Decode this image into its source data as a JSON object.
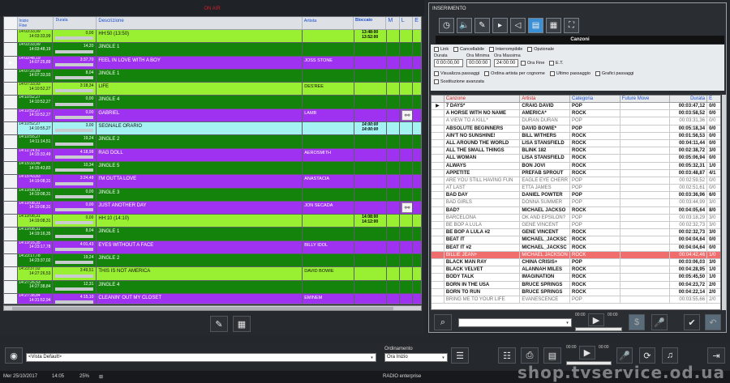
{
  "left_panel": {
    "header_title": "ON AIR",
    "columns": [
      "Inizio\nFine",
      "Durata",
      "Descrizione",
      "Artista",
      "Bloccato",
      "M",
      "L",
      "E"
    ],
    "rows": [
      {
        "start": "14:03:33,99",
        "end": "14:03:33,99",
        "dur": "0,00",
        "desc": "HH:50 (13:50)",
        "artist": "",
        "locked": "13:48:00\n13:52:00",
        "color": "lightg",
        "marker": "",
        "link": false
      },
      {
        "start": "14:03:33,99",
        "end": "14:03:48,19",
        "dur": "14,20",
        "desc": "JINGLE 1",
        "artist": "",
        "locked": "",
        "color": "darkg",
        "marker": "",
        "link": false
      },
      {
        "start": "14:03:48,19",
        "end": "14:07:25,89",
        "dur": "3:37,70",
        "desc": "FEEL IN LOVE WITH A BOY",
        "artist": "JOSS STONE",
        "locked": "",
        "color": "purp",
        "marker": "▶",
        "link": false
      },
      {
        "start": "14:07:25,89",
        "end": "14:07:33,93",
        "dur": "8,04",
        "desc": "JINGLE 1",
        "artist": "",
        "locked": "",
        "color": "darkg",
        "marker": "",
        "link": false
      },
      {
        "start": "14:07:33,93",
        "end": "14:10:52,27",
        "dur": "3:18,34",
        "desc": "LIFE",
        "artist": "DES'REE",
        "locked": "",
        "color": "lightg",
        "marker": "",
        "link": false
      },
      {
        "start": "14:10:52,27",
        "end": "14:10:52,27",
        "dur": "0,00",
        "desc": "JINGLE 4",
        "artist": "",
        "locked": "",
        "color": "darkg",
        "marker": "",
        "link": false
      },
      {
        "start": "14:10:52,27",
        "end": "14:10:52,27",
        "dur": "0,00",
        "desc": "GABRIEL",
        "artist": "LAMB",
        "locked": "",
        "color": "purp",
        "marker": "",
        "link": true
      },
      {
        "start": "14:10:52,27",
        "end": "14:10:55,27",
        "dur": "3,00",
        "desc": "SEGNALE ORARIO",
        "artist": "",
        "locked": "14:00:00\n14:00:00",
        "color": "cyan",
        "marker": "",
        "link": false
      },
      {
        "start": "14:10:55,27",
        "end": "14:11:14,51",
        "dur": "19,24",
        "desc": "JINGLE 2",
        "artist": "",
        "locked": "",
        "color": "darkg",
        "marker": "",
        "link": false
      },
      {
        "start": "14:11:14,51",
        "end": "14:15:33,49",
        "dur": "4:18,98",
        "desc": "RAG DOLL",
        "artist": "AEROSMITH",
        "locked": "",
        "color": "purp",
        "marker": "",
        "link": false
      },
      {
        "start": "14:15:33,49",
        "end": "14:15:43,83",
        "dur": "10,34",
        "desc": "JINGLE 5",
        "artist": "",
        "locked": "",
        "color": "darkg",
        "marker": "",
        "link": false
      },
      {
        "start": "14:15:43,83",
        "end": "14:19:08,31",
        "dur": "3:24,48",
        "desc": "I'M OUTTA LOVE",
        "artist": "ANASTACIA",
        "locked": "",
        "color": "purp",
        "marker": "",
        "link": false
      },
      {
        "start": "14:19:08,31",
        "end": "14:19:08,31",
        "dur": "0,00",
        "desc": "JINGLE 3",
        "artist": "",
        "locked": "",
        "color": "darkg",
        "marker": "",
        "link": false
      },
      {
        "start": "14:19:08,31",
        "end": "14:19:08,31",
        "dur": "0,00",
        "desc": "JUST ANOTHER DAY",
        "artist": "JON SECADA",
        "locked": "",
        "color": "purp",
        "marker": "",
        "link": true
      },
      {
        "start": "14:19:08,31",
        "end": "14:19:08,31",
        "dur": "0,00",
        "desc": "HH:10 (14:10)",
        "artist": "",
        "locked": "14:08:00\n14:12:00",
        "color": "lightg",
        "marker": "",
        "link": false
      },
      {
        "start": "14:19:08,31",
        "end": "14:19:16,35",
        "dur": "8,04",
        "desc": "JINGLE 1",
        "artist": "",
        "locked": "",
        "color": "darkg",
        "marker": "",
        "link": false
      },
      {
        "start": "14:19:16,35",
        "end": "14:23:17,78",
        "dur": "4:01,43",
        "desc": "EYES WITHOUT A FACE",
        "artist": "BILLY IDOL",
        "locked": "",
        "color": "purp",
        "marker": "",
        "link": false
      },
      {
        "start": "14:23:17,78",
        "end": "14:23:37,02",
        "dur": "19,24",
        "desc": "JINGLE 2",
        "artist": "",
        "locked": "",
        "color": "darkg",
        "marker": "",
        "link": false
      },
      {
        "start": "14:23:37,02",
        "end": "14:27:26,53",
        "dur": "3:49,51",
        "desc": "THIS IS NOT AMERICA",
        "artist": "DAVID BOWIE",
        "locked": "",
        "color": "lightg",
        "marker": "",
        "link": false
      },
      {
        "start": "14:27:26,53",
        "end": "14:27:38,84",
        "dur": "12,31",
        "desc": "JINGLE 4",
        "artist": "",
        "locked": "",
        "color": "darkg",
        "marker": "",
        "link": false
      },
      {
        "start": "14:27:38,84",
        "end": "14:31:52,94",
        "dur": "4:15,10",
        "desc": "CLEANIN' OUT MY CLOSET",
        "artist": "EMINEM",
        "locked": "",
        "color": "purp",
        "marker": "",
        "link": false
      }
    ]
  },
  "right_panel": {
    "title": "INSERIMENTO",
    "tab_label": "Canzoni",
    "filters": {
      "link": "Link",
      "cancellabile": "Cancellabile",
      "interrompibile": "Interrompibile",
      "opzionale": "Opzionale",
      "durata_lbl": "Durata",
      "ora_min_lbl": "Ora Minima",
      "ora_max_lbl": "Ora Massima",
      "durata": "0:00:00,00",
      "ora_min": "00:00:00",
      "ora_max": "24:00:00",
      "ora_fine": "Ora Fine",
      "et": "E.T.",
      "visualizza": "Visualizza passaggi",
      "ordina": "Ordina artista per cognome",
      "ultimo": "Ultimo passaggio",
      "grafici": "Grafici passaggi",
      "sostituzione": "Sostituzione avanzata"
    },
    "song_columns": [
      "Canzone",
      "Artista",
      "Categoria",
      "Future Move",
      "Durata",
      "E"
    ],
    "songs": [
      {
        "title": "7 DAYS*",
        "artist": "CRAIG DAVID",
        "cat": "POP",
        "dur": "00:03:47,12",
        "e": "0/0",
        "style": "bold",
        "mark": "▶"
      },
      {
        "title": "A HORSE WITH NO NAME",
        "artist": "AMERICA*",
        "cat": "ROCK",
        "dur": "00:03:58,52",
        "e": "0/0",
        "style": "bold",
        "mark": ""
      },
      {
        "title": "A VIEW TO A KILL*",
        "artist": "DURAN DURAN",
        "cat": "POP",
        "dur": "00:03:31,36",
        "e": "0/0",
        "style": "gray",
        "mark": ""
      },
      {
        "title": "ABSOLUTE BEGINNERS",
        "artist": "DAVID BOWIE*",
        "cat": "POP",
        "dur": "00:05:18,34",
        "e": "0/0",
        "style": "bold",
        "mark": ""
      },
      {
        "title": "AIN'T NO SUNSHINE!",
        "artist": "BILL WITHERS",
        "cat": "ROCK",
        "dur": "00:01:56,53",
        "e": "0/0",
        "style": "bold",
        "mark": ""
      },
      {
        "title": "ALL AROUND THE WORLD",
        "artist": "LISA STANSFIELD",
        "cat": "ROCK",
        "dur": "00:04:11,44",
        "e": "0/0",
        "style": "bold",
        "mark": ""
      },
      {
        "title": "ALL THE SMALL THINGS",
        "artist": "BLINK 182",
        "cat": "ROCK",
        "dur": "00:02:38,72",
        "e": "3/0",
        "style": "bold",
        "mark": ""
      },
      {
        "title": "ALL WOMAN",
        "artist": "LISA STANSFIELD",
        "cat": "ROCK",
        "dur": "00:05:06,94",
        "e": "0/0",
        "style": "bold",
        "mark": ""
      },
      {
        "title": "ALWAYS",
        "artist": "BON JOVI",
        "cat": "ROCK",
        "dur": "00:05:32,31",
        "e": "1/0",
        "style": "bold",
        "mark": ""
      },
      {
        "title": "APPETITE",
        "artist": "PREFAB SPROUT",
        "cat": "ROCK",
        "dur": "00:03:48,87",
        "e": "4/1",
        "style": "bold",
        "mark": ""
      },
      {
        "title": "ARE YOU STILL HAVING FUN",
        "artist": "EAGLE EYE CHERR",
        "cat": "POP",
        "dur": "00:02:59,52",
        "e": "0/0",
        "style": "gray",
        "mark": ""
      },
      {
        "title": "AT LAST",
        "artist": "ETTA JAMES",
        "cat": "POP",
        "dur": "00:02:51,61",
        "e": "0/0",
        "style": "gray",
        "mark": ""
      },
      {
        "title": "BAD DAY",
        "artist": "DANIEL POWTER",
        "cat": "POP",
        "dur": "00:03:36,96",
        "e": "6/0",
        "style": "bold",
        "mark": ""
      },
      {
        "title": "BAD GIRLS",
        "artist": "DONNA SUMMER",
        "cat": "POP",
        "dur": "00:03:44,99",
        "e": "3/0",
        "style": "gray",
        "mark": ""
      },
      {
        "title": "BAD?",
        "artist": "MICHAEL JACKSO",
        "cat": "ROCK",
        "dur": "00:04:05,64",
        "e": "8/0",
        "style": "bold",
        "mark": ""
      },
      {
        "title": "BARCELONA",
        "artist": "OK AND EPSILON?",
        "cat": "POP",
        "dur": "00:03:18,29",
        "e": "3/0",
        "style": "gray",
        "mark": ""
      },
      {
        "title": "BE BOP A LULA",
        "artist": "GENE VINCENT",
        "cat": "POP",
        "dur": "00:02:32,73",
        "e": "3/0",
        "style": "gray",
        "mark": ""
      },
      {
        "title": "BE BOP A LULA #2",
        "artist": "GENE VINCENT",
        "cat": "ROCK",
        "dur": "00:02:32,73",
        "e": "3/0",
        "style": "bold",
        "mark": ""
      },
      {
        "title": "BEAT IT",
        "artist": "MICHAEL_JACKSC",
        "cat": "ROCK",
        "dur": "00:04:04,64",
        "e": "0/0",
        "style": "bold",
        "mark": ""
      },
      {
        "title": "BEAT IT #2",
        "artist": "MICHAEL_JACKSC",
        "cat": "ROCK",
        "dur": "00:04:04,64",
        "e": "0/0",
        "style": "bold",
        "mark": ""
      },
      {
        "title": "BILLIE JEAN+",
        "artist": "MICHAEL JACKSON",
        "cat": "ROCK",
        "dur": "00:04:42,46",
        "e": "1/0",
        "style": "hl",
        "mark": ""
      },
      {
        "title": "BLACK MAN RAY",
        "artist": "CHINA CRISIS+",
        "cat": "POP",
        "dur": "00:03:06,03",
        "e": "3/0",
        "style": "bold",
        "mark": ""
      },
      {
        "title": "BLACK VELVET",
        "artist": "ALANNAH MILES",
        "cat": "ROCK",
        "dur": "00:04:28,95",
        "e": "1/0",
        "style": "bold",
        "mark": ""
      },
      {
        "title": "BODY TALK",
        "artist": "IMAGINATION",
        "cat": "ROCK",
        "dur": "00:05:45,50",
        "e": "1/0",
        "style": "bold",
        "mark": ""
      },
      {
        "title": "BORN IN THE USA",
        "artist": "BRUCE SPRINGS",
        "cat": "ROCK",
        "dur": "00:04:23,72",
        "e": "2/0",
        "style": "bold",
        "mark": ""
      },
      {
        "title": "BORN TO RUN",
        "artist": "BRUCE SPRINGS",
        "cat": "ROCK",
        "dur": "00:04:22,14",
        "e": "2/0",
        "style": "bold",
        "mark": ""
      },
      {
        "title": "BRING ME TO YOUR LIFE",
        "artist": "EVANESCENCE",
        "cat": "POP",
        "dur": "00:03:55,66",
        "e": "2/0",
        "style": "gray",
        "mark": ""
      }
    ],
    "time_lbl1": "00:00",
    "time_lbl2": "00:00"
  },
  "bottom": {
    "vista": "<Vista Default>",
    "ordinamento_lbl": "Ordinamento",
    "ordinamento": "Ora Inizio",
    "time1": "00:00",
    "time2": "00:00"
  },
  "status": {
    "date": "Mer 25/10/2017",
    "time": "14:05",
    "percent": "25%",
    "app": "RADIO enterprise"
  },
  "watermark": "shop.tvservice.od.ua"
}
